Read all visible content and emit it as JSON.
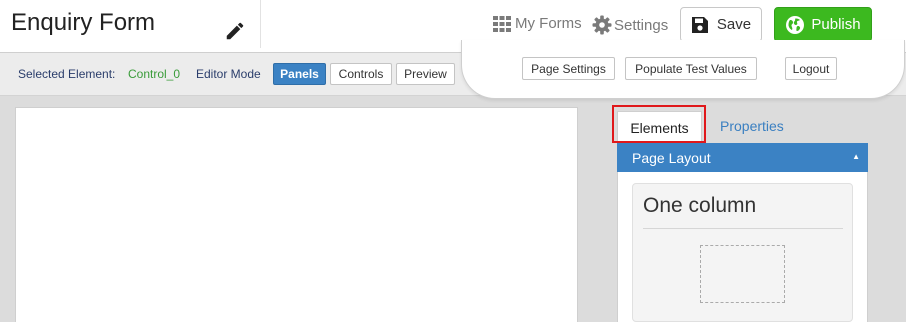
{
  "header": {
    "title": "Enquiry Form",
    "my_forms": "My Forms",
    "settings": "Settings",
    "save": "Save",
    "publish": "Publish"
  },
  "toolbar": {
    "selected_label": "Selected Element:",
    "selected_value": "Control_0",
    "mode_label": "Editor Mode",
    "panels": "Panels",
    "controls": "Controls",
    "preview": "Preview"
  },
  "dropdown": {
    "page_settings": "Page Settings",
    "populate": "Populate Test Values",
    "logout": "Logout"
  },
  "sidepanel": {
    "tab_elements": "Elements",
    "tab_properties": "Properties",
    "section_title": "Page Layout",
    "caret": "▲",
    "card_title": "One column"
  },
  "colors": {
    "accent_blue": "#3b82c4",
    "publish_green": "#3cb91f",
    "highlight_red": "#e0181b"
  }
}
